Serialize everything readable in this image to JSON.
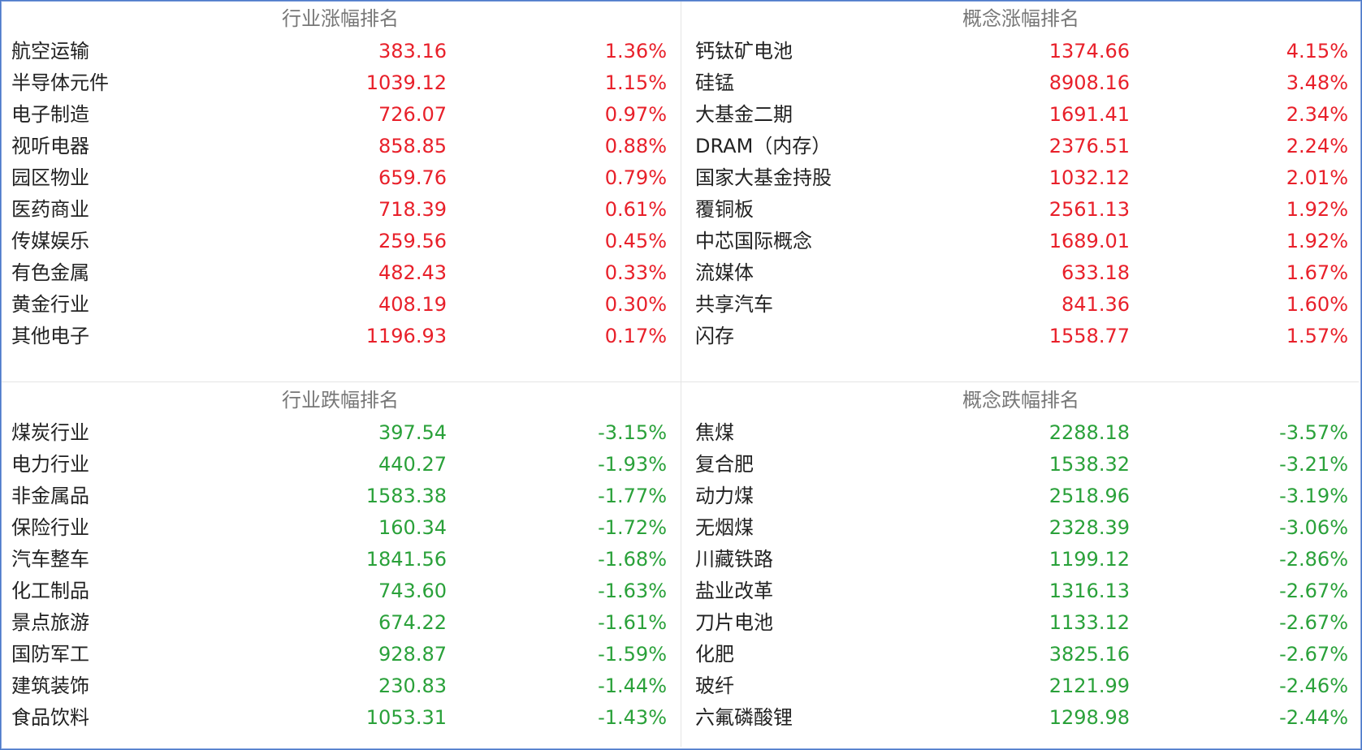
{
  "colors": {
    "up": "#e8202a",
    "down": "#2aa13a",
    "name": "#222222",
    "title": "#777777",
    "frame": "#4a78c8"
  },
  "industry_gain": {
    "title": "行业涨幅排名",
    "rows": [
      {
        "name": "航空运输",
        "value": "383.16",
        "change": "1.36%"
      },
      {
        "name": "半导体元件",
        "value": "1039.12",
        "change": "1.15%"
      },
      {
        "name": "电子制造",
        "value": "726.07",
        "change": "0.97%"
      },
      {
        "name": "视听电器",
        "value": "858.85",
        "change": "0.88%"
      },
      {
        "name": "园区物业",
        "value": "659.76",
        "change": "0.79%"
      },
      {
        "name": "医药商业",
        "value": "718.39",
        "change": "0.61%"
      },
      {
        "name": "传媒娱乐",
        "value": "259.56",
        "change": "0.45%"
      },
      {
        "name": "有色金属",
        "value": "482.43",
        "change": "0.33%"
      },
      {
        "name": "黄金行业",
        "value": "408.19",
        "change": "0.30%"
      },
      {
        "name": "其他电子",
        "value": "1196.93",
        "change": "0.17%"
      }
    ]
  },
  "concept_gain": {
    "title": "概念涨幅排名",
    "rows": [
      {
        "name": "钙钛矿电池",
        "value": "1374.66",
        "change": "4.15%"
      },
      {
        "name": "硅锰",
        "value": "8908.16",
        "change": "3.48%"
      },
      {
        "name": "大基金二期",
        "value": "1691.41",
        "change": "2.34%"
      },
      {
        "name": "DRAM（内存）",
        "value": "2376.51",
        "change": "2.24%"
      },
      {
        "name": "国家大基金持股",
        "value": "1032.12",
        "change": "2.01%"
      },
      {
        "name": "覆铜板",
        "value": "2561.13",
        "change": "1.92%"
      },
      {
        "name": "中芯国际概念",
        "value": "1689.01",
        "change": "1.92%"
      },
      {
        "name": "流媒体",
        "value": "633.18",
        "change": "1.67%"
      },
      {
        "name": "共享汽车",
        "value": "841.36",
        "change": "1.60%"
      },
      {
        "name": "闪存",
        "value": "1558.77",
        "change": "1.57%"
      }
    ]
  },
  "industry_loss": {
    "title": "行业跌幅排名",
    "rows": [
      {
        "name": "煤炭行业",
        "value": "397.54",
        "change": "-3.15%"
      },
      {
        "name": "电力行业",
        "value": "440.27",
        "change": "-1.93%"
      },
      {
        "name": "非金属品",
        "value": "1583.38",
        "change": "-1.77%"
      },
      {
        "name": "保险行业",
        "value": "160.34",
        "change": "-1.72%"
      },
      {
        "name": "汽车整车",
        "value": "1841.56",
        "change": "-1.68%"
      },
      {
        "name": "化工制品",
        "value": "743.60",
        "change": "-1.63%"
      },
      {
        "name": "景点旅游",
        "value": "674.22",
        "change": "-1.61%"
      },
      {
        "name": "国防军工",
        "value": "928.87",
        "change": "-1.59%"
      },
      {
        "name": "建筑装饰",
        "value": "230.83",
        "change": "-1.44%"
      },
      {
        "name": "食品饮料",
        "value": "1053.31",
        "change": "-1.43%"
      }
    ]
  },
  "concept_loss": {
    "title": "概念跌幅排名",
    "rows": [
      {
        "name": "焦煤",
        "value": "2288.18",
        "change": "-3.57%"
      },
      {
        "name": "复合肥",
        "value": "1538.32",
        "change": "-3.21%"
      },
      {
        "name": "动力煤",
        "value": "2518.96",
        "change": "-3.19%"
      },
      {
        "name": "无烟煤",
        "value": "2328.39",
        "change": "-3.06%"
      },
      {
        "name": "川藏铁路",
        "value": "1199.12",
        "change": "-2.86%"
      },
      {
        "name": "盐业改革",
        "value": "1316.13",
        "change": "-2.67%"
      },
      {
        "name": "刀片电池",
        "value": "1133.12",
        "change": "-2.67%"
      },
      {
        "name": "化肥",
        "value": "3825.16",
        "change": "-2.67%"
      },
      {
        "name": "玻纤",
        "value": "2121.99",
        "change": "-2.46%"
      },
      {
        "name": "六氟磷酸锂",
        "value": "1298.98",
        "change": "-2.44%"
      }
    ]
  }
}
